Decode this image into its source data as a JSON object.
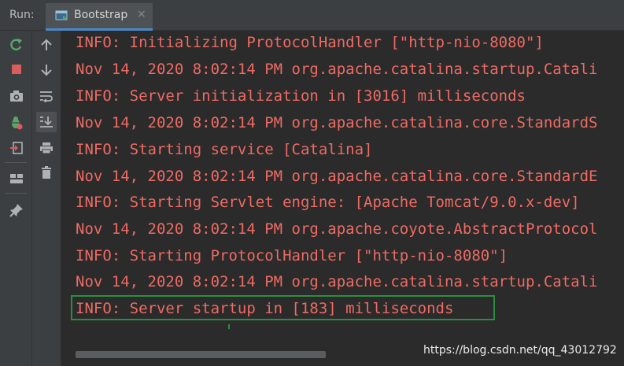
{
  "toolbar": {
    "run_label": "Run:"
  },
  "tab": {
    "title": "Bootstrap",
    "close_symbol": "×",
    "icon": "run-config-icon"
  },
  "left_icons": [
    "rerun-icon",
    "stop-icon",
    "screenshot-icon",
    "debug-icon",
    "exit-icon",
    "layout-icon",
    "pin-icon"
  ],
  "second_icons": [
    "up-arrow-icon",
    "down-arrow-icon",
    "soft-wrap-icon",
    "scroll-to-end-icon",
    "print-icon",
    "trash-icon"
  ],
  "console": {
    "lines": [
      "INFO: Initializing ProtocolHandler [\"http-nio-8080\"]",
      "Nov 14, 2020 8:02:14 PM org.apache.catalina.startup.Catali",
      "INFO: Server initialization in [3016] milliseconds",
      "Nov 14, 2020 8:02:14 PM org.apache.catalina.core.StandardS",
      "INFO: Starting service [Catalina]",
      "Nov 14, 2020 8:02:14 PM org.apache.catalina.core.StandardE",
      "INFO: Starting Servlet engine: [Apache Tomcat/9.0.x-dev]",
      "Nov 14, 2020 8:02:14 PM org.apache.coyote.AbstractProtocol",
      "INFO: Starting ProtocolHandler [\"http-nio-8080\"]",
      "Nov 14, 2020 8:02:14 PM org.apache.catalina.startup.Catali",
      "INFO: Server startup in [183] milliseconds"
    ],
    "text_color": "#ee6b63",
    "highlight_color": "#2c8d3c"
  },
  "watermark": "https://blog.csdn.net/qq_43012792"
}
